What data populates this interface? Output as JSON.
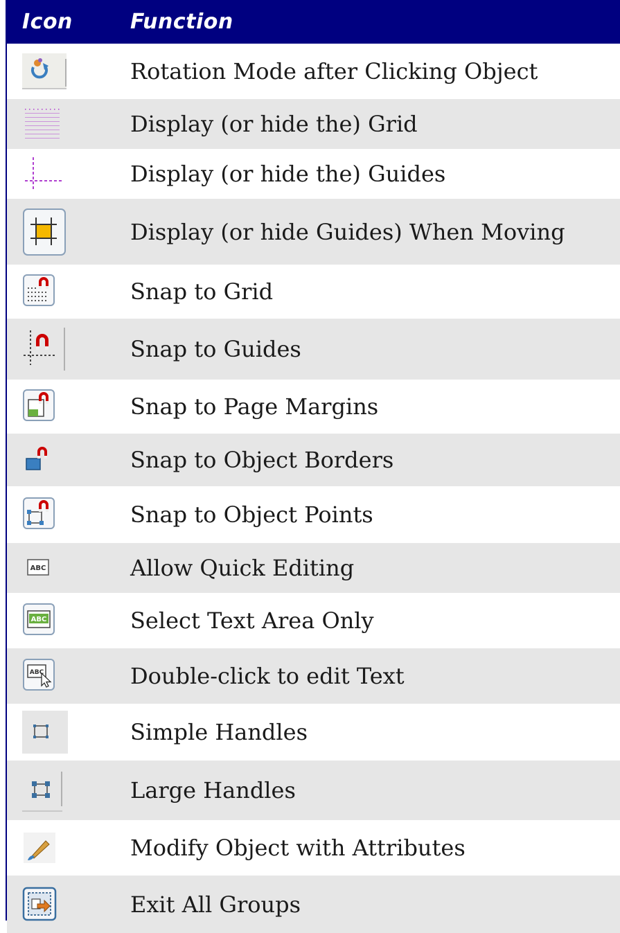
{
  "header": {
    "icon": "Icon",
    "function": "Function"
  },
  "rows": [
    {
      "icon": "rotation-mode-icon",
      "label": "Rotation Mode after Clicking Object"
    },
    {
      "icon": "grid-icon",
      "label": "Display (or hide the) Grid"
    },
    {
      "icon": "guides-icon",
      "label": "Display (or hide the) Guides"
    },
    {
      "icon": "guides-when-moving-icon",
      "label": "Display (or hide Guides) When Moving"
    },
    {
      "icon": "snap-to-grid-icon",
      "label": "Snap to Grid"
    },
    {
      "icon": "snap-to-guides-icon",
      "label": "Snap to Guides"
    },
    {
      "icon": "snap-to-page-margins-icon",
      "label": "Snap to Page Margins"
    },
    {
      "icon": "snap-to-object-borders-icon",
      "label": "Snap to Object Borders"
    },
    {
      "icon": "snap-to-object-points-icon",
      "label": "Snap to Object Points"
    },
    {
      "icon": "quick-edit-icon",
      "label": "Allow Quick Editing"
    },
    {
      "icon": "select-text-area-icon",
      "label": "Select Text Area Only"
    },
    {
      "icon": "double-click-edit-icon",
      "label": "Double-click to edit Text"
    },
    {
      "icon": "simple-handles-icon",
      "label": "Simple Handles"
    },
    {
      "icon": "large-handles-icon",
      "label": "Large Handles"
    },
    {
      "icon": "modify-with-attributes-icon",
      "label": "Modify Object with Attributes"
    },
    {
      "icon": "exit-all-groups-icon",
      "label": "Exit All Groups"
    }
  ],
  "colors": {
    "header_bg": "#000080",
    "header_text": "#ffffff",
    "row_shade": "#e6e6e6",
    "magnet": "#cc0000",
    "guide": "#b040d0"
  }
}
